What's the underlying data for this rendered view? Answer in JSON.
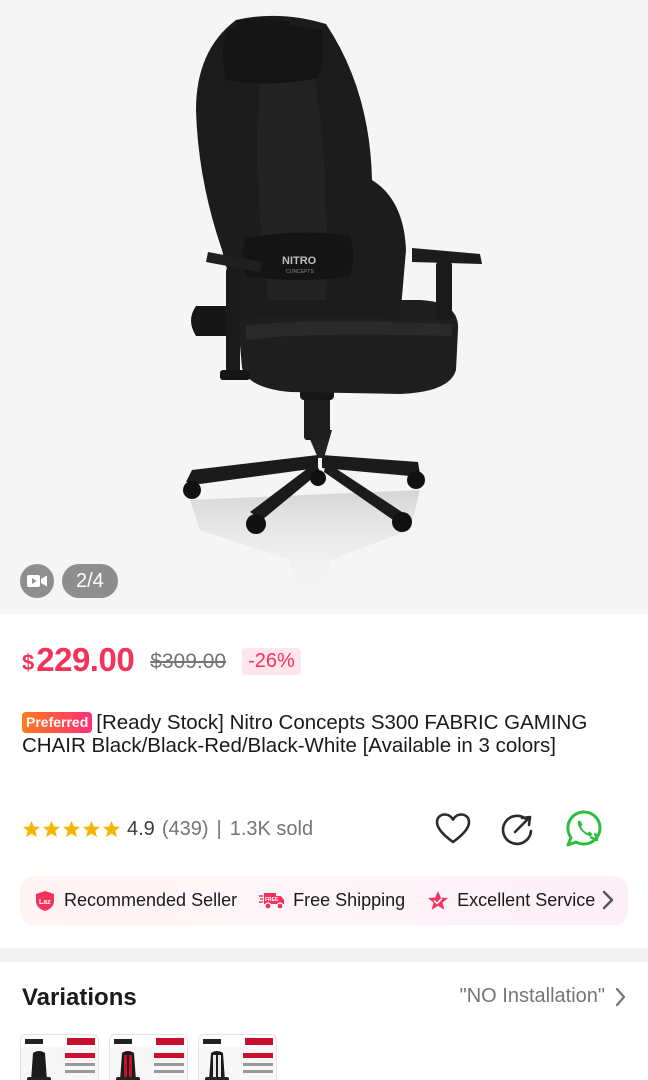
{
  "gallery": {
    "image_alt": "Nitro Concepts S300 gaming chair",
    "chair_logo_top": "NITRO",
    "chair_logo_bottom": "CONCEPTS",
    "counter": "2/4",
    "video_icon": "video-camera-icon"
  },
  "price": {
    "currency": "$",
    "current": "229.00",
    "original": "$309.00",
    "discount": "-26%"
  },
  "product": {
    "badge": "Preferred",
    "title": "[Ready Stock] Nitro Concepts S300 FABRIC GAMING CHAIR Black/Black-Red/Black-White [Available in 3 colors]"
  },
  "rating": {
    "stars": 5,
    "score": "4.9",
    "reviews": "(439)",
    "separator": "|",
    "sold": "1.3K sold"
  },
  "actions": {
    "wishlist_icon": "heart-icon",
    "share_icon": "share-icon",
    "whatsapp_icon": "whatsapp-icon"
  },
  "services": [
    {
      "icon": "laz-badge-icon",
      "label": "Recommended Seller"
    },
    {
      "icon": "free-shipping-truck-icon",
      "label": "Free Shipping"
    },
    {
      "icon": "excellent-service-star-icon",
      "label": "Excellent Service"
    }
  ],
  "variations": {
    "title": "Variations",
    "selected": "\"NO Installation\"",
    "thumbnails": [
      "Black",
      "Black-Red",
      "Black-White"
    ]
  },
  "colors": {
    "accent": "#f5325c",
    "muted": "#757575",
    "star": "#f7b500",
    "whatsapp": "#2ebd3f"
  }
}
